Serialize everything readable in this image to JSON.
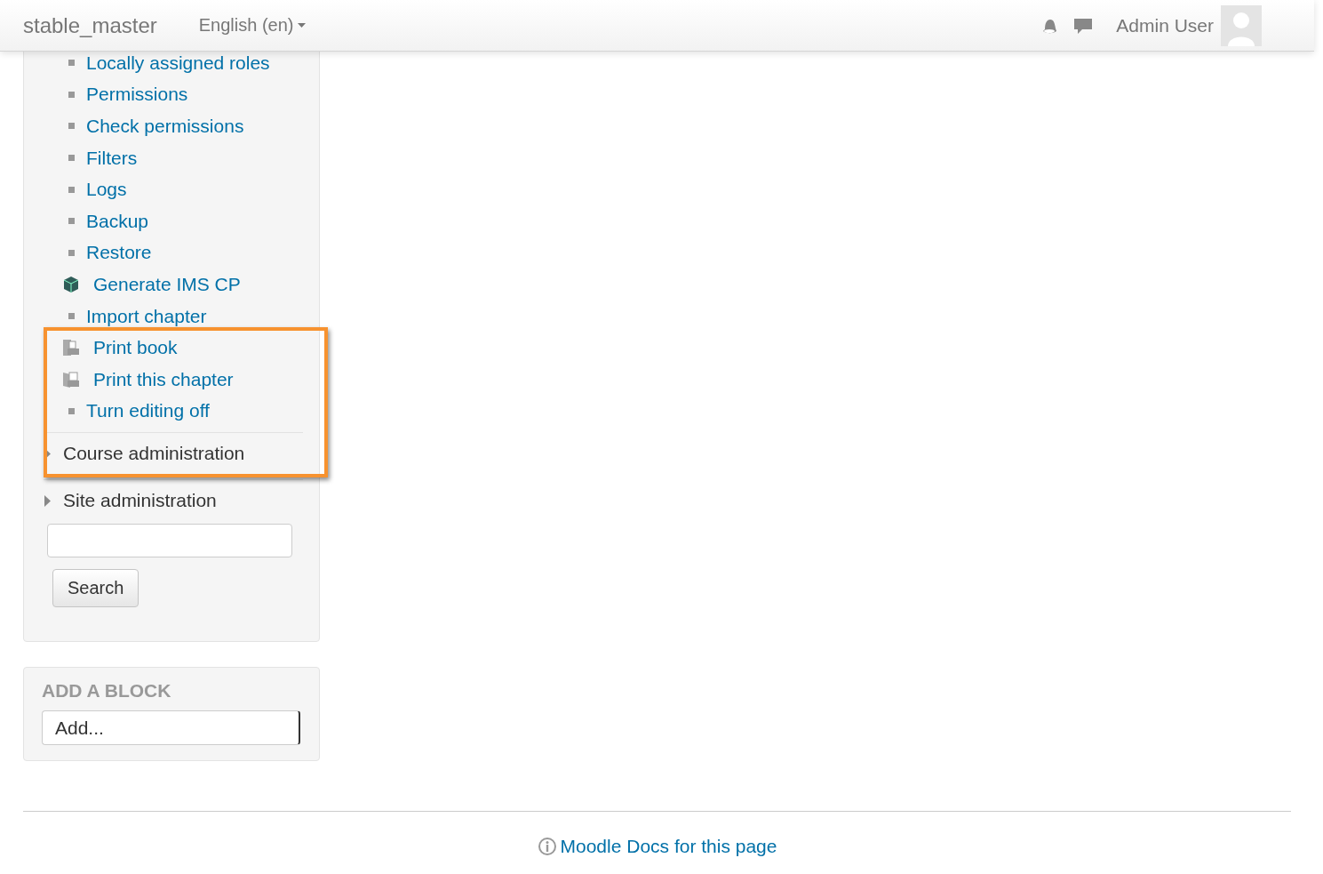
{
  "navbar": {
    "site_name": "stable_master",
    "language": "English (en)",
    "user_name": "Admin User"
  },
  "administration": {
    "items": [
      {
        "label": "Locally assigned roles",
        "kind": "bullet"
      },
      {
        "label": "Permissions",
        "kind": "bullet"
      },
      {
        "label": "Check permissions",
        "kind": "bullet"
      },
      {
        "label": "Filters",
        "kind": "bullet"
      },
      {
        "label": "Logs",
        "kind": "bullet"
      },
      {
        "label": "Backup",
        "kind": "bullet"
      },
      {
        "label": "Restore",
        "kind": "bullet"
      },
      {
        "label": "Generate IMS CP",
        "kind": "package"
      },
      {
        "label": "Import chapter",
        "kind": "bullet"
      },
      {
        "label": "Print book",
        "kind": "print-book"
      },
      {
        "label": "Print this chapter",
        "kind": "print-chapter"
      },
      {
        "label": "Turn editing off",
        "kind": "bullet"
      }
    ],
    "sections": [
      {
        "label": "Course administration",
        "expanded": false
      },
      {
        "label": "Site administration",
        "expanded": false
      }
    ],
    "search_button": "Search"
  },
  "add_block": {
    "title": "ADD A BLOCK",
    "select": "Add..."
  },
  "footer": {
    "docs_link": "Moodle Docs for this page"
  }
}
